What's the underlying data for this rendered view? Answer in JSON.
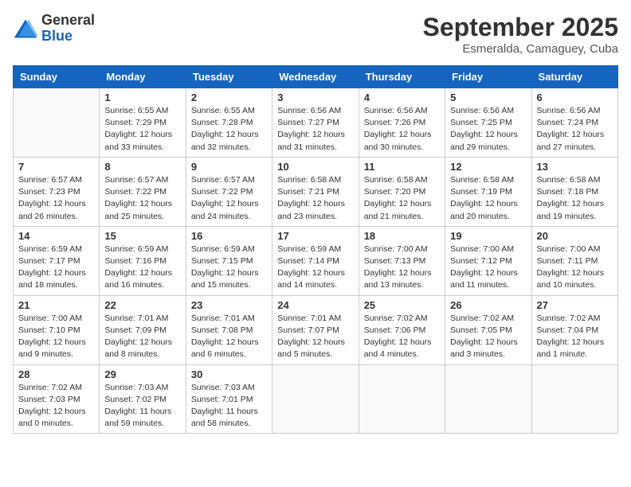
{
  "header": {
    "logo_general": "General",
    "logo_blue": "Blue",
    "month": "September 2025",
    "location": "Esmeralda, Camaguey, Cuba"
  },
  "weekdays": [
    "Sunday",
    "Monday",
    "Tuesday",
    "Wednesday",
    "Thursday",
    "Friday",
    "Saturday"
  ],
  "weeks": [
    [
      {
        "day": "",
        "info": ""
      },
      {
        "day": "1",
        "info": "Sunrise: 6:55 AM\nSunset: 7:29 PM\nDaylight: 12 hours\nand 33 minutes."
      },
      {
        "day": "2",
        "info": "Sunrise: 6:55 AM\nSunset: 7:28 PM\nDaylight: 12 hours\nand 32 minutes."
      },
      {
        "day": "3",
        "info": "Sunrise: 6:56 AM\nSunset: 7:27 PM\nDaylight: 12 hours\nand 31 minutes."
      },
      {
        "day": "4",
        "info": "Sunrise: 6:56 AM\nSunset: 7:26 PM\nDaylight: 12 hours\nand 30 minutes."
      },
      {
        "day": "5",
        "info": "Sunrise: 6:56 AM\nSunset: 7:25 PM\nDaylight: 12 hours\nand 29 minutes."
      },
      {
        "day": "6",
        "info": "Sunrise: 6:56 AM\nSunset: 7:24 PM\nDaylight: 12 hours\nand 27 minutes."
      }
    ],
    [
      {
        "day": "7",
        "info": "Sunrise: 6:57 AM\nSunset: 7:23 PM\nDaylight: 12 hours\nand 26 minutes."
      },
      {
        "day": "8",
        "info": "Sunrise: 6:57 AM\nSunset: 7:22 PM\nDaylight: 12 hours\nand 25 minutes."
      },
      {
        "day": "9",
        "info": "Sunrise: 6:57 AM\nSunset: 7:22 PM\nDaylight: 12 hours\nand 24 minutes."
      },
      {
        "day": "10",
        "info": "Sunrise: 6:58 AM\nSunset: 7:21 PM\nDaylight: 12 hours\nand 23 minutes."
      },
      {
        "day": "11",
        "info": "Sunrise: 6:58 AM\nSunset: 7:20 PM\nDaylight: 12 hours\nand 21 minutes."
      },
      {
        "day": "12",
        "info": "Sunrise: 6:58 AM\nSunset: 7:19 PM\nDaylight: 12 hours\nand 20 minutes."
      },
      {
        "day": "13",
        "info": "Sunrise: 6:58 AM\nSunset: 7:18 PM\nDaylight: 12 hours\nand 19 minutes."
      }
    ],
    [
      {
        "day": "14",
        "info": "Sunrise: 6:59 AM\nSunset: 7:17 PM\nDaylight: 12 hours\nand 18 minutes."
      },
      {
        "day": "15",
        "info": "Sunrise: 6:59 AM\nSunset: 7:16 PM\nDaylight: 12 hours\nand 16 minutes."
      },
      {
        "day": "16",
        "info": "Sunrise: 6:59 AM\nSunset: 7:15 PM\nDaylight: 12 hours\nand 15 minutes."
      },
      {
        "day": "17",
        "info": "Sunrise: 6:59 AM\nSunset: 7:14 PM\nDaylight: 12 hours\nand 14 minutes."
      },
      {
        "day": "18",
        "info": "Sunrise: 7:00 AM\nSunset: 7:13 PM\nDaylight: 12 hours\nand 13 minutes."
      },
      {
        "day": "19",
        "info": "Sunrise: 7:00 AM\nSunset: 7:12 PM\nDaylight: 12 hours\nand 11 minutes."
      },
      {
        "day": "20",
        "info": "Sunrise: 7:00 AM\nSunset: 7:11 PM\nDaylight: 12 hours\nand 10 minutes."
      }
    ],
    [
      {
        "day": "21",
        "info": "Sunrise: 7:00 AM\nSunset: 7:10 PM\nDaylight: 12 hours\nand 9 minutes."
      },
      {
        "day": "22",
        "info": "Sunrise: 7:01 AM\nSunset: 7:09 PM\nDaylight: 12 hours\nand 8 minutes."
      },
      {
        "day": "23",
        "info": "Sunrise: 7:01 AM\nSunset: 7:08 PM\nDaylight: 12 hours\nand 6 minutes."
      },
      {
        "day": "24",
        "info": "Sunrise: 7:01 AM\nSunset: 7:07 PM\nDaylight: 12 hours\nand 5 minutes."
      },
      {
        "day": "25",
        "info": "Sunrise: 7:02 AM\nSunset: 7:06 PM\nDaylight: 12 hours\nand 4 minutes."
      },
      {
        "day": "26",
        "info": "Sunrise: 7:02 AM\nSunset: 7:05 PM\nDaylight: 12 hours\nand 3 minutes."
      },
      {
        "day": "27",
        "info": "Sunrise: 7:02 AM\nSunset: 7:04 PM\nDaylight: 12 hours\nand 1 minute."
      }
    ],
    [
      {
        "day": "28",
        "info": "Sunrise: 7:02 AM\nSunset: 7:03 PM\nDaylight: 12 hours\nand 0 minutes."
      },
      {
        "day": "29",
        "info": "Sunrise: 7:03 AM\nSunset: 7:02 PM\nDaylight: 11 hours\nand 59 minutes."
      },
      {
        "day": "30",
        "info": "Sunrise: 7:03 AM\nSunset: 7:01 PM\nDaylight: 11 hours\nand 58 minutes."
      },
      {
        "day": "",
        "info": ""
      },
      {
        "day": "",
        "info": ""
      },
      {
        "day": "",
        "info": ""
      },
      {
        "day": "",
        "info": ""
      }
    ]
  ]
}
